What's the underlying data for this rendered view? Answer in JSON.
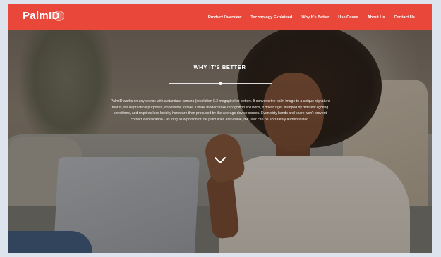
{
  "header": {
    "logo_text": "PalmID",
    "brand_color": "#e9473a",
    "nav": [
      {
        "label": "Product Overview"
      },
      {
        "label": "Technology Explained"
      },
      {
        "label": "Why It's Better"
      },
      {
        "label": "Use Cases"
      },
      {
        "label": "About Us"
      },
      {
        "label": "Contact Us"
      }
    ]
  },
  "hero": {
    "title": "WHY IT'S BETTER",
    "description": "PalmID works on any device with a standard camera (resolution 0.3 megapixel or better). It converts the palm image to a unique signature that is, for all practical purposes, impossible to fake. Unlike modern fake recognition solutions, it doesn't get stumped by different lighting conditions, and requires less lucidity hardware than produced by the average device screen. Even dirty hands and scars won't prevent correct identification - as long as a portion of the palm lines are visible, the user can be accurately authenticated.",
    "scroll_icon": "chevron-down-icon"
  }
}
